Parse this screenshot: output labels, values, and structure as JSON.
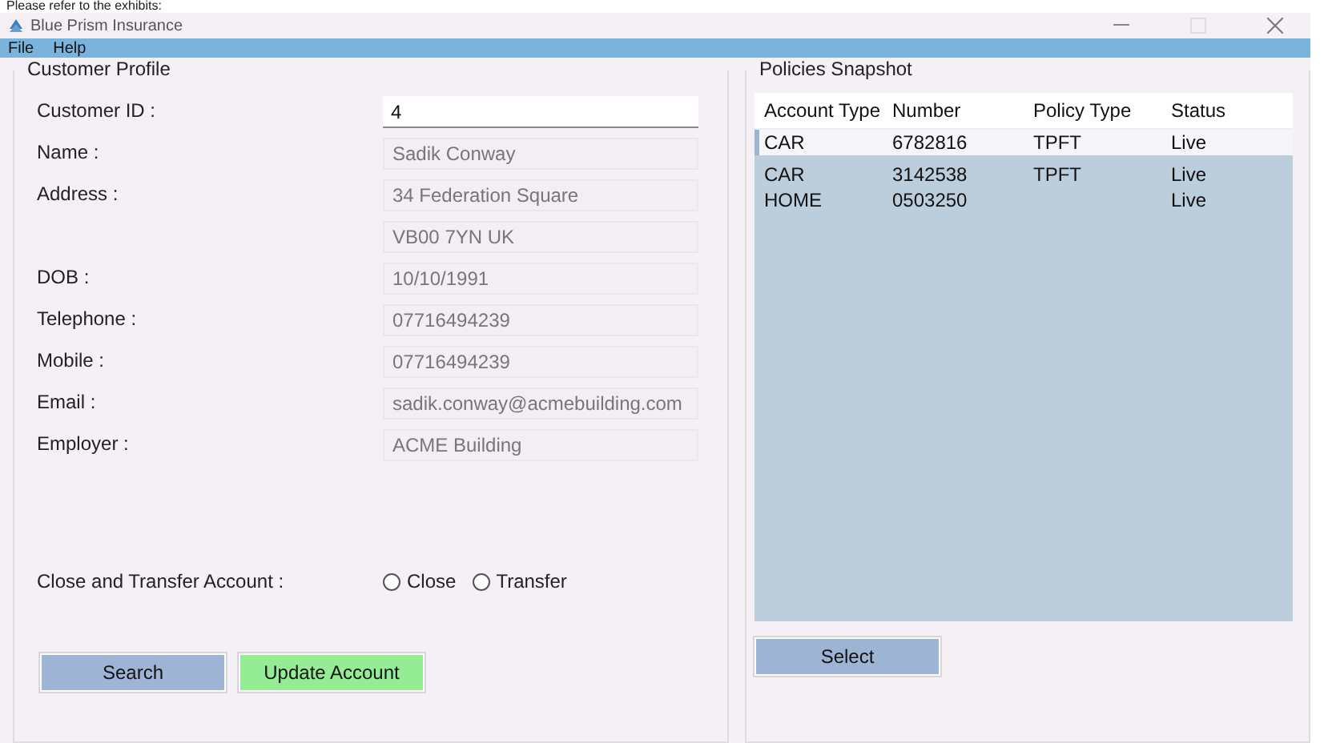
{
  "exhibit_note": "Please refer to the exhibits:",
  "window": {
    "title": "Blue Prism Insurance"
  },
  "menu": [
    "File",
    "Help"
  ],
  "customer_profile": {
    "title": "Customer Profile",
    "fields": [
      {
        "label": "Customer ID :",
        "values": [
          "4"
        ],
        "editable": true
      },
      {
        "label": "Name :",
        "values": [
          "Sadik Conway"
        ],
        "editable": false
      },
      {
        "label": "Address :",
        "values": [
          "34 Federation Square",
          "VB00 7YN UK"
        ],
        "editable": false
      },
      {
        "label": "DOB :",
        "values": [
          "10/10/1991"
        ],
        "editable": false
      },
      {
        "label": "Telephone :",
        "values": [
          "07716494239"
        ],
        "editable": false
      },
      {
        "label": "Mobile :",
        "values": [
          "07716494239"
        ],
        "editable": false
      },
      {
        "label": "Email :",
        "values": [
          "sadik.conway@acmebuilding.com"
        ],
        "editable": false
      },
      {
        "label": "Employer :",
        "values": [
          "ACME Building"
        ],
        "editable": false
      }
    ],
    "close_transfer": {
      "label": "Close and Transfer Account :",
      "options": [
        {
          "label": "Close",
          "selected": false
        },
        {
          "label": "Transfer",
          "selected": false
        }
      ]
    },
    "buttons": [
      {
        "label": "Search",
        "kind": "primary"
      },
      {
        "label": "Update Account",
        "kind": "success"
      }
    ]
  },
  "policies_snapshot": {
    "title": "Policies Snapshot",
    "table": {
      "columns": [
        "Account Type",
        "Number",
        "Policy Type",
        "Status"
      ],
      "rows": [
        {
          "cells": [
            "CAR",
            "6782816",
            "TPFT",
            "Live"
          ],
          "selected": true
        },
        {
          "cells": [
            "CAR",
            "3142538",
            "TPFT",
            "Live"
          ],
          "selected": false
        },
        {
          "cells": [
            "HOME",
            "0503250",
            "",
            "Live"
          ],
          "selected": false
        }
      ]
    },
    "buttons": [
      {
        "label": "Select",
        "kind": "primary"
      }
    ]
  }
}
